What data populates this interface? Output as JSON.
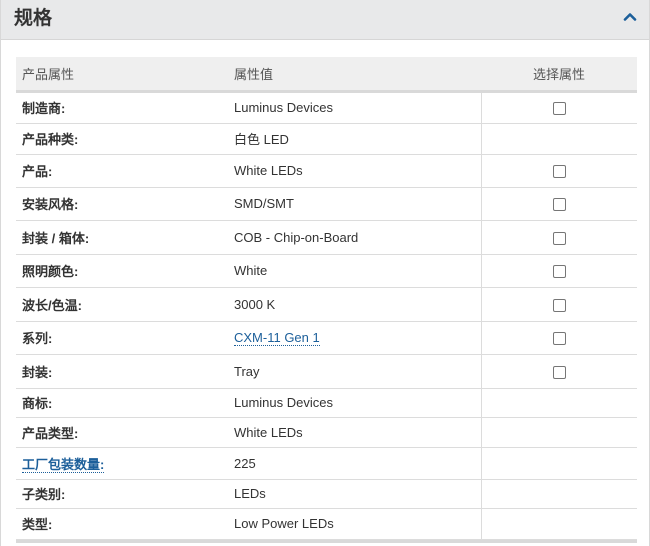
{
  "panel": {
    "title": "规格",
    "collapse_icon": "chevron-up-icon",
    "accent_color": "#1c5f9a"
  },
  "table": {
    "headers": {
      "attribute": "产品属性",
      "value": "属性值",
      "select": "选择属性"
    },
    "rows": [
      {
        "name": "制造商:",
        "value": "Luminus Devices",
        "has_checkbox": true,
        "name_is_link": false,
        "value_is_link": false
      },
      {
        "name": "产品种类:",
        "value": "白色 LED",
        "has_checkbox": false,
        "name_is_link": false,
        "value_is_link": false
      },
      {
        "name": "产品:",
        "value": "White LEDs",
        "has_checkbox": true,
        "name_is_link": false,
        "value_is_link": false
      },
      {
        "name": "安装风格:",
        "value": "SMD/SMT",
        "has_checkbox": true,
        "name_is_link": false,
        "value_is_link": false
      },
      {
        "name": "封装 / 箱体:",
        "value": "COB - Chip-on-Board",
        "has_checkbox": true,
        "name_is_link": false,
        "value_is_link": false
      },
      {
        "name": "照明颜色:",
        "value": "White",
        "has_checkbox": true,
        "name_is_link": false,
        "value_is_link": false
      },
      {
        "name": "波长/色温:",
        "value": "3000 K",
        "has_checkbox": true,
        "name_is_link": false,
        "value_is_link": false
      },
      {
        "name": "系列:",
        "value": "CXM-11 Gen 1",
        "has_checkbox": true,
        "name_is_link": false,
        "value_is_link": true
      },
      {
        "name": "封装:",
        "value": "Tray",
        "has_checkbox": true,
        "name_is_link": false,
        "value_is_link": false
      },
      {
        "name": "商标:",
        "value": "Luminus Devices",
        "has_checkbox": false,
        "name_is_link": false,
        "value_is_link": false
      },
      {
        "name": "产品类型:",
        "value": "White LEDs",
        "has_checkbox": false,
        "name_is_link": false,
        "value_is_link": false
      },
      {
        "name": "工厂包装数量:",
        "value": "225",
        "has_checkbox": false,
        "name_is_link": true,
        "value_is_link": false
      },
      {
        "name": "子类别:",
        "value": "LEDs",
        "has_checkbox": false,
        "name_is_link": false,
        "value_is_link": false
      },
      {
        "name": "类型:",
        "value": "Low Power LEDs",
        "has_checkbox": false,
        "name_is_link": false,
        "value_is_link": false
      }
    ]
  }
}
